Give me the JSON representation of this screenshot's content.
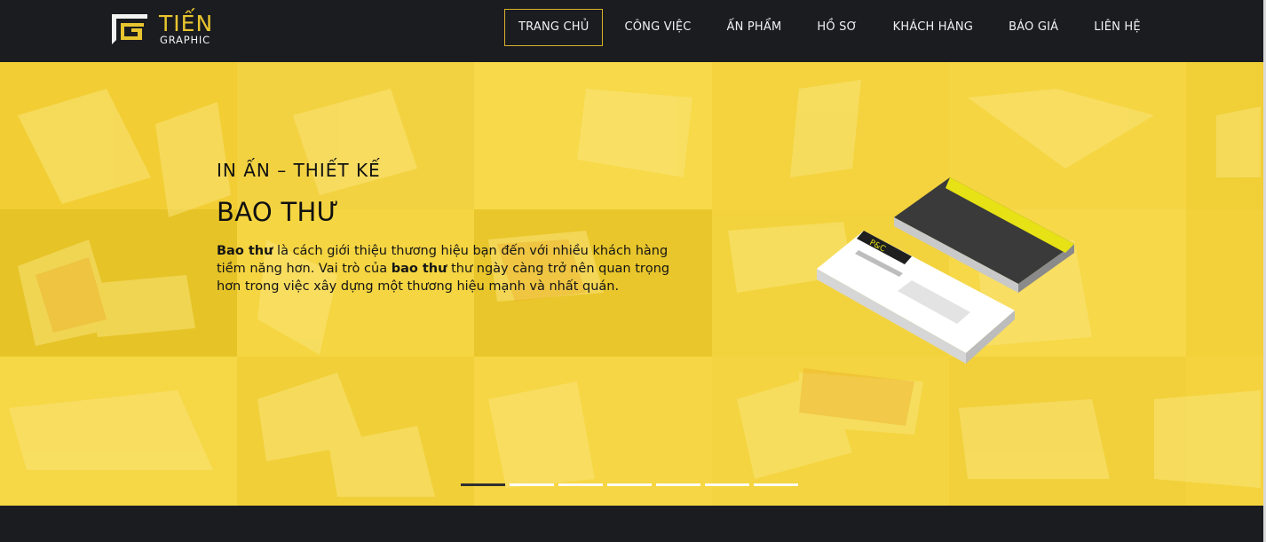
{
  "brand": {
    "title": "TIẾN",
    "subtitle": "GRAPHIC"
  },
  "nav": {
    "items": [
      {
        "label": "TRANG CHỦ",
        "active": true
      },
      {
        "label": "CÔNG VIỆC",
        "active": false
      },
      {
        "label": "ẤN PHẨM",
        "active": false
      },
      {
        "label": "HỒ SƠ",
        "active": false
      },
      {
        "label": "KHÁCH HÀNG",
        "active": false
      },
      {
        "label": "BÁO GIÁ",
        "active": false
      },
      {
        "label": "LIÊN HỆ",
        "active": false
      }
    ]
  },
  "hero": {
    "kicker": "IN ẤN – THIẾT KẾ",
    "title": "BAO THƯ",
    "desc_b1": "Bao thư",
    "desc_t1": " là cách giới thiệu thương hiệu bạn đến với nhiều khách hàng tiềm năng hơn. Vai trò của ",
    "desc_b2": "bao thư",
    "desc_t2": " thư ngày càng trở nên quan trọng hơn trong việc xây dựng một thương hiệu mạnh và nhất quán.",
    "envelope_logo": "P&C"
  },
  "slider": {
    "count": 7,
    "active_index": 0
  },
  "colors": {
    "accent": "#e8c52f",
    "header_bg": "#1b1c20",
    "hero_bg": "#f6d23a"
  }
}
